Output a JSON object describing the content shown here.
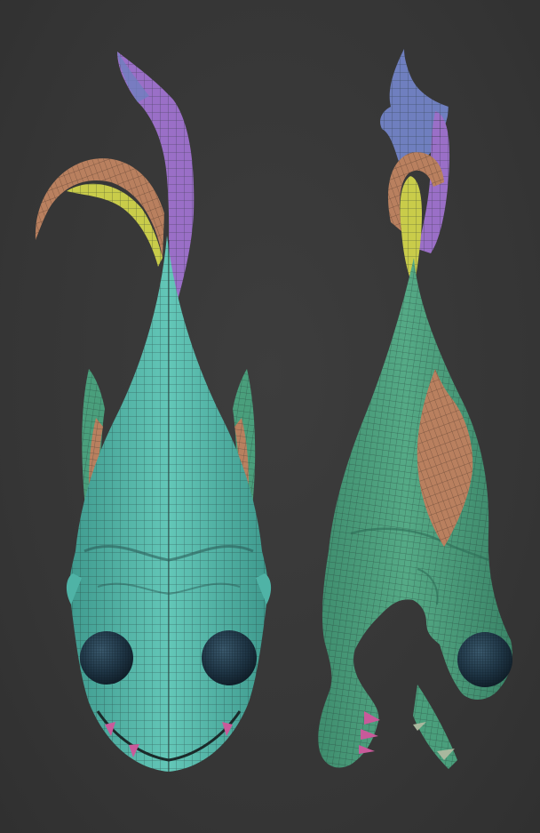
{
  "scene": {
    "colors": {
      "background": "#383838",
      "body_teal": "#4fb3a6",
      "body_teal_light": "#63c7b8",
      "body_green": "#4a9f7c",
      "fin_orange": "#b9805f",
      "fin_yellow": "#c9cc4a",
      "tail_purple": "#9a6fc7",
      "tail_blue": "#6f7fbf",
      "eye": "#1d3443",
      "teeth_pink": "#c95a9a",
      "wire": "#1e2b2a"
    },
    "views": [
      {
        "name": "front-view",
        "icon": "creature-front-icon"
      },
      {
        "name": "side-view",
        "icon": "creature-side-icon"
      }
    ]
  }
}
